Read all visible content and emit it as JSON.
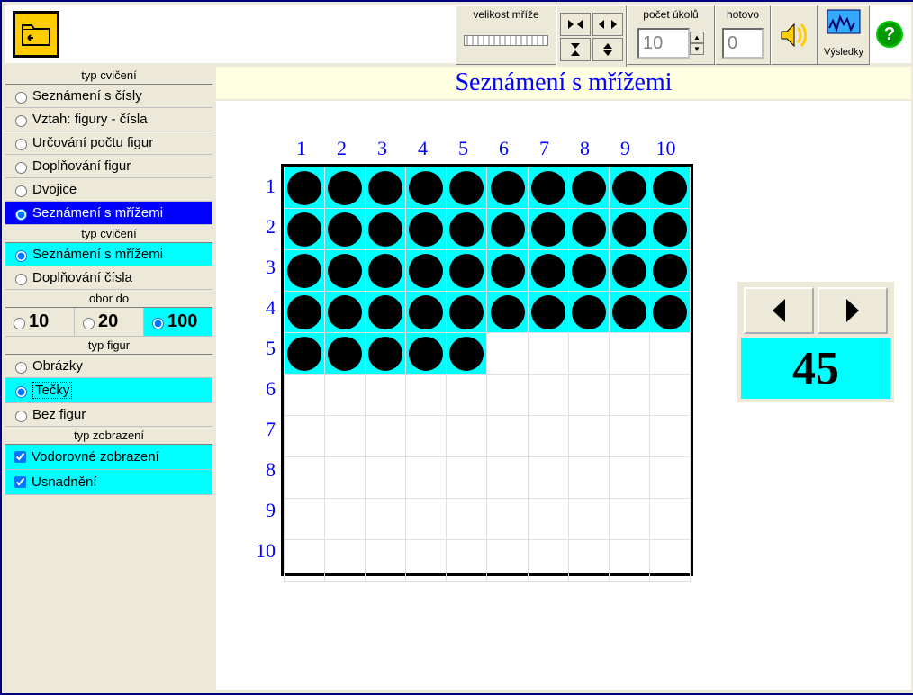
{
  "toolbar": {
    "grid_size_label": "velikost mříže",
    "tasks_label": "počet úkolů",
    "tasks_value": "10",
    "done_label": "hotovo",
    "done_value": "0",
    "results_label": "Výsledky"
  },
  "title": "Seznámení s mřížemi",
  "sections": {
    "typ_cviceni": "typ cvičení",
    "typ_cviceni2": "typ cvičení",
    "obor_do": "obor do",
    "typ_figur": "typ figur",
    "typ_zobrazeni": "typ zobrazení"
  },
  "opts1": [
    "Seznámení s čísly",
    "Vztah: figury - čísla",
    "Určování počtu figur",
    "Doplňování figur",
    "Dvojice",
    "Seznámení s mřížemi"
  ],
  "opts2": [
    "Seznámení s mřížemi",
    "Doplňování čísla"
  ],
  "ranges": [
    "10",
    "20",
    "100"
  ],
  "figures": [
    "Obrázky",
    "Tečky",
    "Bez figur"
  ],
  "display": [
    "Vodorovné  zobrazení",
    "Usnadnění"
  ],
  "cols": [
    "1",
    "2",
    "3",
    "4",
    "5",
    "6",
    "7",
    "8",
    "9",
    "10"
  ],
  "rows": [
    "1",
    "2",
    "3",
    "4",
    "5",
    "6",
    "7",
    "8",
    "9",
    "10"
  ],
  "filled_count": 45,
  "panel_value": "45"
}
